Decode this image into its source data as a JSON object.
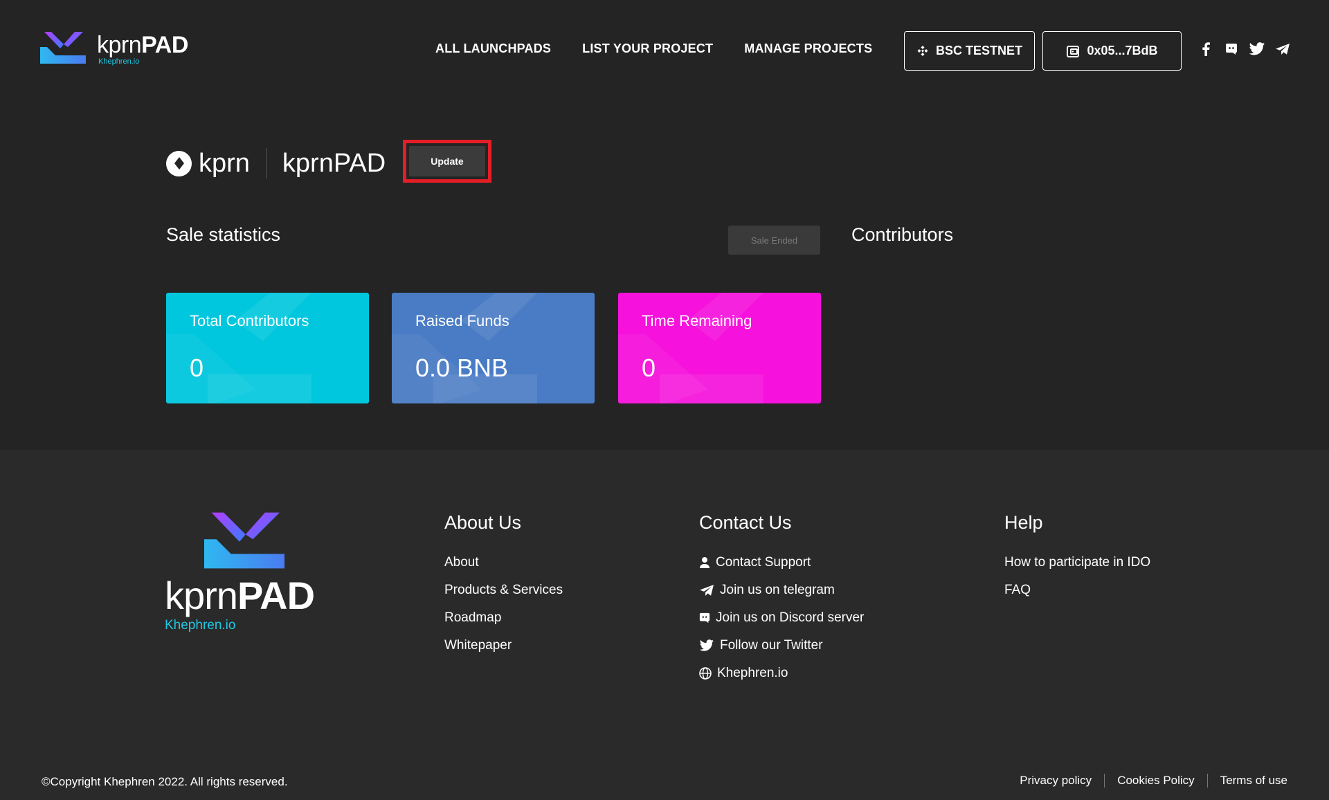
{
  "header": {
    "logo_word_light": "kprn",
    "logo_word_bold": "PAD",
    "logo_sub": "Khephren.io",
    "nav": [
      "ALL LAUNCHPADS",
      "LIST YOUR PROJECT",
      "MANAGE PROJECTS"
    ],
    "network_label": "BSC TESTNET",
    "wallet_label": "0x05...7BdB",
    "social_icons": [
      "facebook-icon",
      "discord-icon",
      "twitter-icon",
      "telegram-icon"
    ]
  },
  "project": {
    "symbol": "kprn",
    "name": "kprnPAD",
    "update_label": "Update"
  },
  "stats": {
    "title": "Sale statistics",
    "status_label": "Sale Ended",
    "contributors_title": "Contributors",
    "cards": [
      {
        "label": "Total Contributors",
        "value": "0",
        "color": "#00c7de"
      },
      {
        "label": "Raised Funds",
        "value": "0.0 BNB",
        "color": "#4a7cc5"
      },
      {
        "label": "Time Remaining",
        "value": "0",
        "color": "#f611dc"
      }
    ]
  },
  "footer": {
    "logo_word_light": "kprn",
    "logo_word_bold": "PAD",
    "logo_sub": "Khephren.io",
    "about": {
      "title": "About Us",
      "links": [
        "About",
        "Products & Services",
        "Roadmap",
        "Whitepaper"
      ]
    },
    "contact": {
      "title": "Contact Us",
      "links": [
        {
          "label": "Contact Support",
          "icon": "user-icon"
        },
        {
          "label": "Join us on telegram",
          "icon": "telegram-icon"
        },
        {
          "label": "Join us on Discord server",
          "icon": "discord-icon"
        },
        {
          "label": "Follow our Twitter",
          "icon": "twitter-icon"
        },
        {
          "label": "Khephren.io",
          "icon": "globe-icon"
        }
      ]
    },
    "help": {
      "title": "Help",
      "links": [
        "How to participate in IDO",
        "FAQ"
      ]
    },
    "copyright": "©Copyright Khephren 2022. All rights reserved.",
    "legal": [
      "Privacy policy",
      "Cookies Policy",
      "Terms of use"
    ]
  },
  "colors": {
    "background": "#242424",
    "footer_background": "#2a2a2a",
    "accent_cyan": "#20c9e5",
    "highlight_red": "#e41e26"
  }
}
